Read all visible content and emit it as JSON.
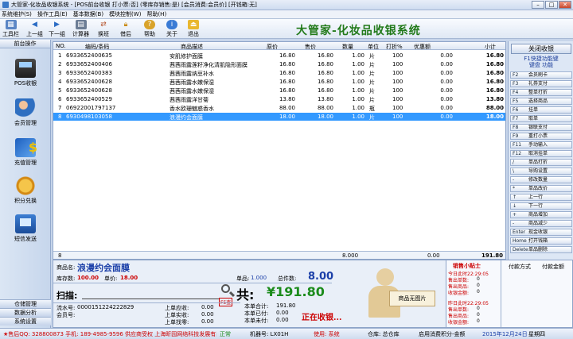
{
  "titlebar": {
    "title": "大管家-化妆品收银系统 - [POS前台收银 打小票:否] (零库存销售:是) [会员消费:会员价] [开钱箱:无]"
  },
  "menu": {
    "items": [
      "系统维护(S)",
      "操作工具(E)",
      "基本数据(B)",
      "模块控制(W)",
      "帮助(H)"
    ]
  },
  "toolbar": {
    "buttons": [
      {
        "label": "工具栏",
        "icon": "toolbar-icon"
      },
      {
        "label": "上一组",
        "icon": "arrow-left-icon"
      },
      {
        "label": "下一组",
        "icon": "arrow-right-icon"
      },
      {
        "label": "计算器",
        "icon": "calculator-icon"
      },
      {
        "label": "换班",
        "icon": "shift-icon"
      },
      {
        "label": "借后",
        "icon": "lock-icon"
      },
      {
        "label": "帮助",
        "icon": "help-icon"
      },
      {
        "label": "关于",
        "icon": "info-icon"
      },
      {
        "label": "退出",
        "icon": "exit-icon"
      }
    ],
    "brand": "大管家-化妆品收银系统"
  },
  "left": {
    "header": "前台操作",
    "items": [
      {
        "label": "POS收银",
        "icon": "pos-icon"
      },
      {
        "label": "会员管理",
        "icon": "members-icon"
      },
      {
        "label": "充值管理",
        "icon": "recharge-icon"
      },
      {
        "label": "积分兑换",
        "icon": "points-icon"
      },
      {
        "label": "短信发送",
        "icon": "sms-icon"
      }
    ],
    "footer": [
      "仓储管理",
      "数据分析",
      "系统设置"
    ]
  },
  "grid": {
    "headers": [
      "NO.",
      "编码/条码",
      "商品描述",
      "原价",
      "售价",
      "数量",
      "单位",
      "打折%",
      "优惠额",
      "小计"
    ],
    "rows": [
      [
        "1",
        "6933652400635",
        "安肌修护面膜",
        "16.80",
        "16.80",
        "1.00",
        "片",
        "100",
        "0.00",
        "16.80"
      ],
      [
        "2",
        "6933652400406",
        "茜茜雨露莲籽净化清肌隐形面膜",
        "16.80",
        "16.80",
        "1.00",
        "片",
        "100",
        "0.00",
        "16.80"
      ],
      [
        "3",
        "6933652400383",
        "茜茜雨露纳豆补水",
        "16.80",
        "16.80",
        "1.00",
        "片",
        "100",
        "0.00",
        "16.80"
      ],
      [
        "4",
        "6933652400628",
        "茜茜雨露水嫩保湿",
        "16.80",
        "16.80",
        "1.00",
        "片",
        "100",
        "0.00",
        "16.80"
      ],
      [
        "5",
        "6933652400628",
        "茜茜雨露水嫩保湿",
        "16.80",
        "16.80",
        "1.00",
        "片",
        "100",
        "0.00",
        "16.80"
      ],
      [
        "6",
        "6933652400529",
        "茜茜雨露洋甘菊",
        "13.80",
        "13.80",
        "1.00",
        "片",
        "100",
        "0.00",
        "13.80"
      ],
      [
        "7",
        "06922001797137",
        "香水欧珊魅惑香水",
        "88.00",
        "88.00",
        "1.00",
        "瓶",
        "100",
        "0.00",
        "88.00"
      ],
      [
        "8",
        "6930498103058",
        "浪漫约会面膜",
        "18.00",
        "18.00",
        "1.00",
        "片",
        "100",
        "0.00",
        "18.00"
      ]
    ],
    "selected_row": 7,
    "total": {
      "count": "8",
      "qty": "8.000",
      "discount": "0.00",
      "subtotal": "191.80"
    }
  },
  "right": {
    "close_label": "关闭收银",
    "tip_lines": [
      "F1快捷功能键",
      "键盘    功能"
    ],
    "keys": [
      {
        "k": "F2",
        "l": "会员刷卡"
      },
      {
        "k": "F3",
        "l": "礼券支付"
      },
      {
        "k": "F4",
        "l": "整单打折"
      },
      {
        "k": "F5",
        "l": "选择商品"
      },
      {
        "k": "F6",
        "l": "挂单"
      },
      {
        "k": "F7",
        "l": "取单"
      },
      {
        "k": "F8",
        "l": "银联支付"
      },
      {
        "k": "F9",
        "l": "重打小票"
      },
      {
        "k": "F11",
        "l": "手动输入"
      },
      {
        "k": "F12",
        "l": "取消挂单"
      },
      {
        "k": "/",
        "l": "单品打折"
      },
      {
        "k": "\\",
        "l": "导购设置"
      },
      {
        "k": "-",
        "l": "修改数量"
      },
      {
        "k": "*",
        "l": "单品改价"
      },
      {
        "k": "↑",
        "l": "上一行"
      },
      {
        "k": "↓",
        "l": "下一行"
      },
      {
        "k": "+",
        "l": "商品增加"
      },
      {
        "k": "-",
        "l": "商品减少"
      },
      {
        "k": "Enter",
        "l": "现金收银"
      },
      {
        "k": "Home",
        "l": "打开钱箱"
      },
      {
        "k": "Delete",
        "l": "单品删除"
      }
    ]
  },
  "info": {
    "name_label": "商品名:",
    "name": "浪漫约会面膜",
    "stock_label": "库存数:",
    "stock": "100.00",
    "unit_price_label": "单价:",
    "unit_price": "18.00",
    "single_label": "单品:",
    "single": "1.000",
    "total_items_label": "总件数:",
    "total_items": "8.00",
    "total_label": "共:",
    "total": "¥191.80",
    "scan_label": "扫描:",
    "serial_label": "流水号:",
    "serial": "0000151224222829",
    "member_label": "会员号:",
    "member": "",
    "upper_due_label": "上单应收:",
    "upper_due": "0.00",
    "upper_paid_label": "上单实收:",
    "upper_paid": "0.00",
    "upper_change_label": "上单找零:",
    "upper_change": "0.00",
    "cur_total_label": "本单合计:",
    "cur_total": "191.80",
    "cur_paid_label": "本单已付:",
    "cur_paid": "0.00",
    "cur_unpaid_label": "本单未付:",
    "cur_unpaid": "0.00",
    "status_text": "正在收银...",
    "no_image_text": "商品无图片",
    "status_tag": "F5查"
  },
  "side": {
    "title": "销售小贴士",
    "today_title": "今日此时22:29:05",
    "yesterday_title": "昨日此时22:29:05",
    "today": [
      {
        "k": "售出单数:",
        "v": "0"
      },
      {
        "k": "售出商品:",
        "v": "0"
      },
      {
        "k": "收银金额:",
        "v": "0"
      }
    ],
    "yesterday": [
      {
        "k": "售出单数:",
        "v": "0"
      },
      {
        "k": "售出商品:",
        "v": "0"
      },
      {
        "k": "收银金额:",
        "v": "0"
      }
    ],
    "pay_method_label": "付款方式",
    "pay_amount_label": "付款金额"
  },
  "status": {
    "items": [
      "★售后QQ: 328800873 手机: 189-4985-9596 供应商受权 上海昕园网络科技发展有限公司",
      "正常",
      "机器号: LX01H",
      "使用: 系统",
      "仓库: 总仓库",
      "启用消费积分-金额",
      "2015年12月24日",
      "星期四"
    ]
  }
}
